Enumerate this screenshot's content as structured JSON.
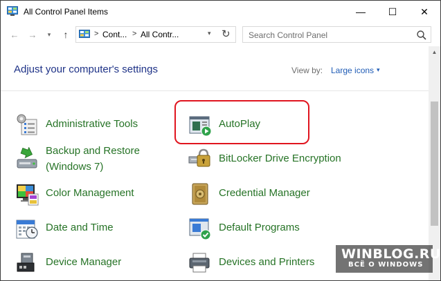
{
  "window": {
    "title": "All Control Panel Items",
    "minimize_glyph": "—",
    "maximize_glyph": "☐",
    "close_glyph": "✕"
  },
  "nav": {
    "back_glyph": "←",
    "forward_glyph": "→",
    "recent_glyph": "▾",
    "up_glyph": "↑"
  },
  "address": {
    "crumbs": [
      "Cont...",
      "All Contr..."
    ],
    "separator": ">",
    "dropdown_glyph": "▾",
    "refresh_glyph": "↻"
  },
  "search": {
    "placeholder": "Search Control Panel"
  },
  "content": {
    "heading": "Adjust your computer's settings",
    "view_by_label": "View by:",
    "view_by_value": "Large icons",
    "view_by_caret": "▾"
  },
  "items": [
    {
      "label": "Administrative Tools",
      "icon": "administrative-tools-icon"
    },
    {
      "label": "AutoPlay",
      "icon": "autoplay-icon"
    },
    {
      "label_line1": "Backup and Restore",
      "label_line2": "(Windows 7)",
      "icon": "backup-restore-icon"
    },
    {
      "label": "BitLocker Drive Encryption",
      "icon": "bitlocker-icon"
    },
    {
      "label": "Color Management",
      "icon": "color-management-icon"
    },
    {
      "label": "Credential Manager",
      "icon": "credential-manager-icon"
    },
    {
      "label": "Date and Time",
      "icon": "date-time-icon"
    },
    {
      "label": "Default Programs",
      "icon": "default-programs-icon"
    },
    {
      "label": "Device Manager",
      "icon": "device-manager-icon"
    },
    {
      "label": "Devices and Printers",
      "icon": "devices-printers-icon"
    }
  ],
  "scrollbar": {
    "up_glyph": "▲"
  },
  "watermark": {
    "line1": "WINBLOG.RU",
    "line2": "ВСЁ О WINDOWS"
  },
  "colors": {
    "heading": "#1e3287",
    "link_green": "#267326",
    "highlight": "#e0141e",
    "viewby_value": "#1e5bb5"
  }
}
